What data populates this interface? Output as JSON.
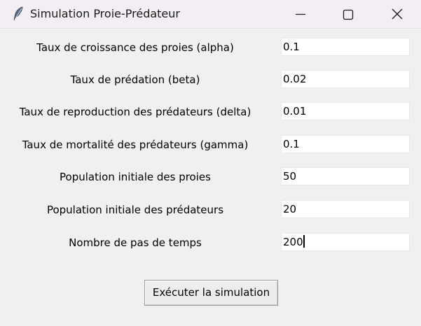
{
  "window": {
    "title": "Simulation Proie-Prédateur",
    "icon": "feather-icon"
  },
  "fields": [
    {
      "label": "Taux de croissance des proies (alpha)",
      "value": "0.1"
    },
    {
      "label": "Taux de prédation (beta)",
      "value": "0.02"
    },
    {
      "label": "Taux de reproduction des prédateurs (delta)",
      "value": "0.01"
    },
    {
      "label": "Taux de mortalité des prédateurs (gamma)",
      "value": "0.1"
    },
    {
      "label": "Population initiale des proies",
      "value": "50"
    },
    {
      "label": "Population initiale des prédateurs",
      "value": "20"
    },
    {
      "label": "Nombre de pas de temps",
      "value": "200"
    }
  ],
  "run_button": {
    "label": "Exécuter la simulation"
  }
}
